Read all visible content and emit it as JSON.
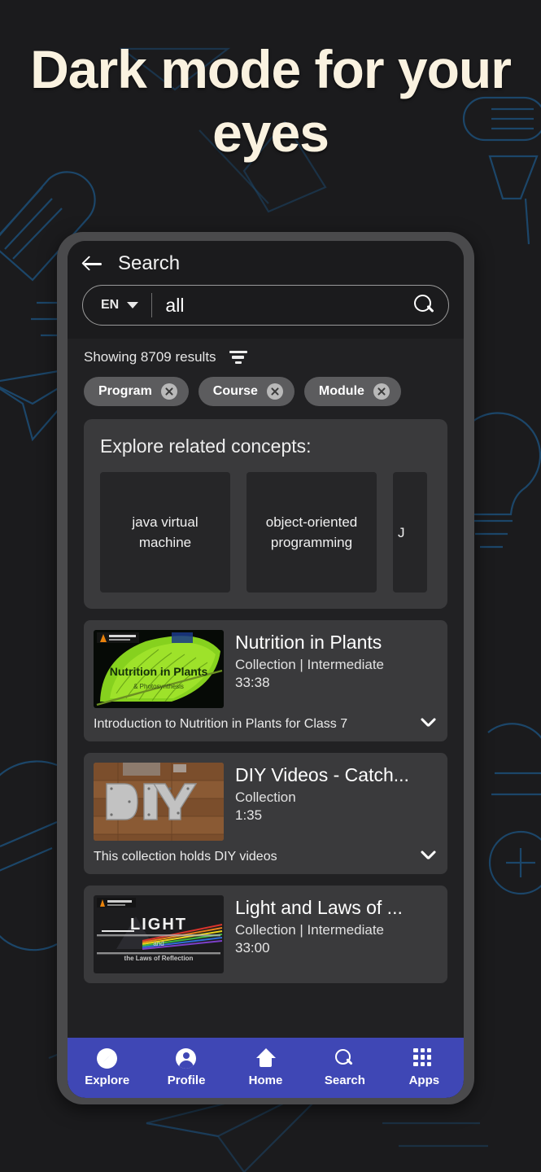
{
  "headline": "Dark mode for your eyes",
  "colors": {
    "page_bg": "#1b1b1d",
    "headline": "#faf2e0",
    "phone_bezel": "#4a4a4c",
    "screen_bg": "#212123",
    "panel_bg": "#3a3a3c",
    "tile_bg": "#262628",
    "chip_bg": "#5c5c5e",
    "nav_bar": "#3f47b5",
    "doodle_line": "#1d4f78"
  },
  "app": {
    "header": {
      "back_icon": "back-arrow-icon",
      "title": "Search",
      "search": {
        "language": "EN",
        "caret_icon": "chevron-down-icon",
        "query": "all",
        "placeholder": "Search",
        "search_icon": "search-icon"
      }
    },
    "results_meta": {
      "text": "Showing 8709 results",
      "filter_icon": "filter-icon"
    },
    "chips": [
      {
        "label": "Program",
        "close_icon": "close-circle-icon"
      },
      {
        "label": "Course",
        "close_icon": "close-circle-icon"
      },
      {
        "label": "Module",
        "close_icon": "close-circle-icon"
      }
    ],
    "concepts": {
      "title": "Explore related concepts:",
      "tiles": [
        {
          "label": "java virtual machine"
        },
        {
          "label": "object-oriented programming"
        },
        {
          "label": "J"
        }
      ]
    },
    "results": [
      {
        "title": "Nutrition in Plants",
        "subtitle": "Collection | Intermediate",
        "duration": "33:38",
        "description": "Introduction to Nutrition in Plants for Class 7",
        "expand_icon": "chevron-down-icon",
        "thumbnail": "nutrition-in-plants-leaf-thumbnail",
        "thumb_overlay": "Nutrition in Plants",
        "thumb_overlay_sub": "& Photosynthesis"
      },
      {
        "title": "DIY Videos - Catch...",
        "subtitle": "Collection",
        "duration": "1:35",
        "description": "This collection holds DIY videos",
        "expand_icon": "chevron-down-icon",
        "thumbnail": "diy-metal-letters-wood-thumbnail",
        "thumb_overlay": "DIY",
        "thumb_overlay_sub": ""
      },
      {
        "title": "Light and Laws of ...",
        "subtitle": "Collection | Intermediate",
        "duration": "33:00",
        "description": "",
        "expand_icon": "chevron-down-icon",
        "thumbnail": "light-prism-rainbow-thumbnail",
        "thumb_overlay": "LIGHT",
        "thumb_overlay_sub": "the Laws of Reflection"
      }
    ],
    "bottom_nav": [
      {
        "label": "Explore",
        "icon": "compass-icon"
      },
      {
        "label": "Profile",
        "icon": "person-icon"
      },
      {
        "label": "Home",
        "icon": "home-icon"
      },
      {
        "label": "Search",
        "icon": "search-icon"
      },
      {
        "label": "Apps",
        "icon": "grid-apps-icon"
      }
    ]
  }
}
